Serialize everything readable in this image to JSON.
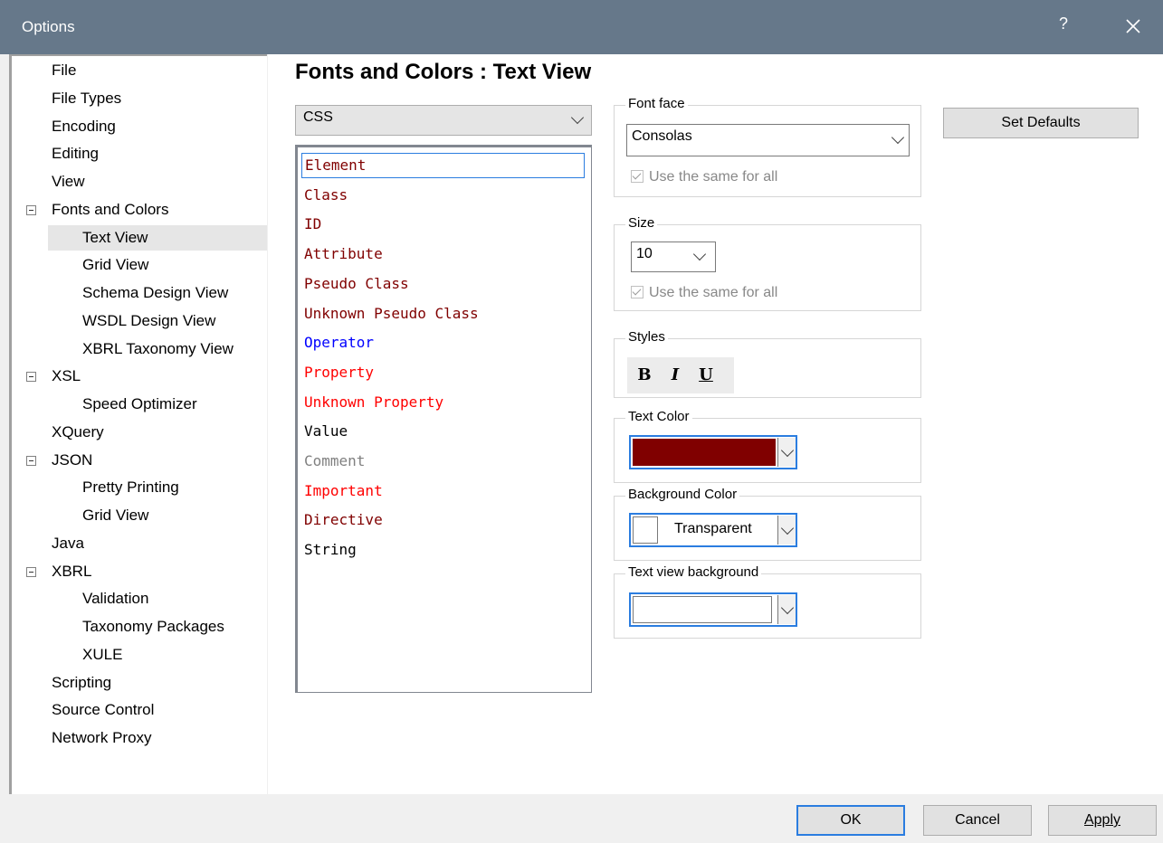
{
  "window": {
    "title": "Options",
    "help_label": "?"
  },
  "tree": {
    "items": [
      {
        "label": "File",
        "level": 0
      },
      {
        "label": "File Types",
        "level": 0
      },
      {
        "label": "Encoding",
        "level": 0
      },
      {
        "label": "Editing",
        "level": 0
      },
      {
        "label": "View",
        "level": 0
      },
      {
        "label": "Fonts and Colors",
        "level": 0,
        "expanded": true
      },
      {
        "label": "Text View",
        "level": 1,
        "selected": true
      },
      {
        "label": "Grid View",
        "level": 1
      },
      {
        "label": "Schema Design View",
        "level": 1
      },
      {
        "label": "WSDL Design View",
        "level": 1
      },
      {
        "label": "XBRL Taxonomy View",
        "level": 1
      },
      {
        "label": "XSL",
        "level": 0,
        "expanded": true
      },
      {
        "label": "Speed Optimizer",
        "level": 1
      },
      {
        "label": "XQuery",
        "level": 0
      },
      {
        "label": "JSON",
        "level": 0,
        "expanded": true
      },
      {
        "label": "Pretty Printing",
        "level": 1
      },
      {
        "label": "Grid View",
        "level": 1
      },
      {
        "label": "Java",
        "level": 0
      },
      {
        "label": "XBRL",
        "level": 0,
        "expanded": true
      },
      {
        "label": "Validation",
        "level": 1
      },
      {
        "label": "Taxonomy Packages",
        "level": 1
      },
      {
        "label": "XULE",
        "level": 1
      },
      {
        "label": "Scripting",
        "level": 0
      },
      {
        "label": "Source Control",
        "level": 0
      },
      {
        "label": "Network Proxy",
        "level": 0
      }
    ]
  },
  "page": {
    "heading": "Fonts and Colors : Text View",
    "language_select": "CSS",
    "elements": [
      {
        "label": "Element",
        "color": "#800000",
        "selected": true
      },
      {
        "label": "Class",
        "color": "#800000"
      },
      {
        "label": "ID",
        "color": "#800000"
      },
      {
        "label": "Attribute",
        "color": "#800000"
      },
      {
        "label": "Pseudo Class",
        "color": "#800000"
      },
      {
        "label": "Unknown Pseudo Class",
        "color": "#800000"
      },
      {
        "label": "Operator",
        "color": "#0000ff"
      },
      {
        "label": "Property",
        "color": "#ff0000"
      },
      {
        "label": "Unknown Property",
        "color": "#ff0000"
      },
      {
        "label": "Value",
        "color": "#000000"
      },
      {
        "label": "Comment",
        "color": "#808080"
      },
      {
        "label": "Important",
        "color": "#ff0000"
      },
      {
        "label": "Directive",
        "color": "#800000"
      },
      {
        "label": "String",
        "color": "#000000"
      }
    ]
  },
  "font_face": {
    "legend": "Font face",
    "value": "Consolas",
    "same_for_all": "Use the same for all"
  },
  "size": {
    "legend": "Size",
    "value": "10",
    "same_for_all": "Use the same for all"
  },
  "styles": {
    "legend": "Styles",
    "bold": "B",
    "italic": "I",
    "underline": "U"
  },
  "text_color": {
    "legend": "Text Color",
    "color": "#800000"
  },
  "background_color": {
    "legend": "Background Color",
    "value": "Transparent"
  },
  "text_view_background": {
    "legend": "Text view background",
    "color": "#ffffff"
  },
  "buttons": {
    "set_defaults": "Set Defaults",
    "ok": "OK",
    "cancel": "Cancel",
    "apply": "Apply"
  },
  "accent": "#2b7de0",
  "titlebar_color": "#66788a"
}
